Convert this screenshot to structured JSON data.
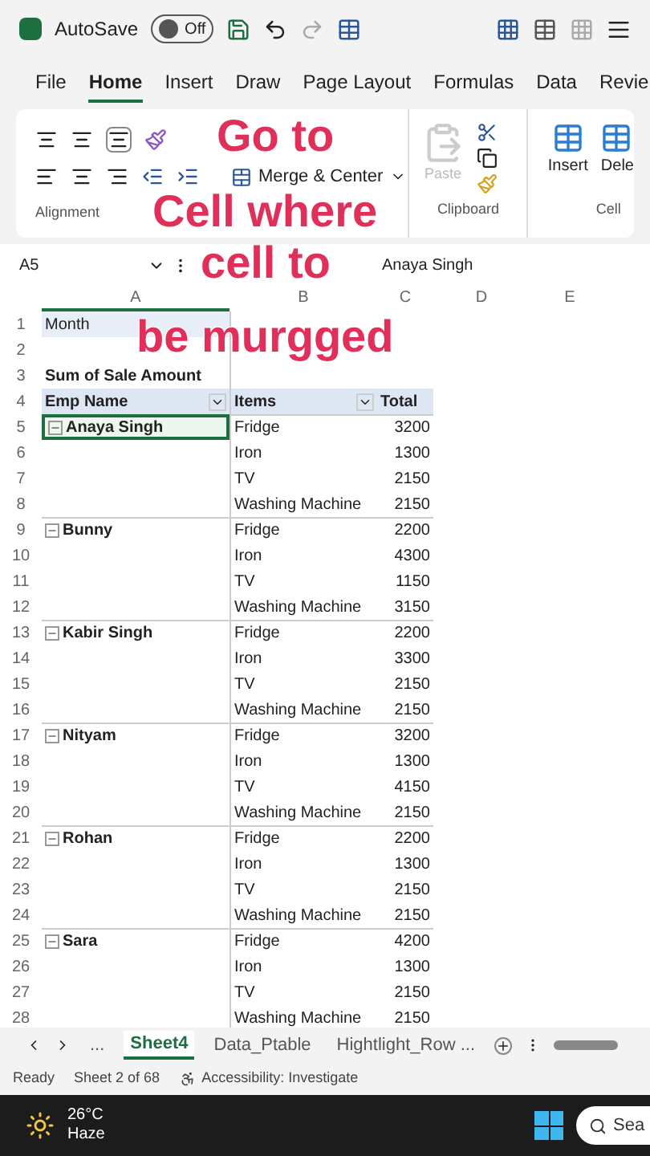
{
  "title_bar": {
    "autosave_label": "AutoSave",
    "autosave": {
      "on": false,
      "label": "Off"
    }
  },
  "menu_tabs": [
    {
      "label": "File",
      "selected": false
    },
    {
      "label": "Home",
      "selected": true
    },
    {
      "label": "Insert",
      "selected": false
    },
    {
      "label": "Draw",
      "selected": false
    },
    {
      "label": "Page Layout",
      "selected": false
    },
    {
      "label": "Formulas",
      "selected": false
    },
    {
      "label": "Data",
      "selected": false
    },
    {
      "label": "Revie",
      "selected": false
    }
  ],
  "ribbon": {
    "merge_button": "Merge & Center",
    "alignment_label": "Alignment",
    "paste": {
      "label": "Paste",
      "disabled": true
    },
    "clipboard_label": "Clipboard",
    "insert": "Insert",
    "delete": "Dele",
    "cells_label": "Cell"
  },
  "formula_bar": {
    "name_box": "A5",
    "value": "Anaya Singh"
  },
  "columns": [
    {
      "label": "A",
      "selected": true
    },
    {
      "label": "B",
      "selected": false
    },
    {
      "label": "C",
      "selected": false
    },
    {
      "label": "D",
      "selected": false
    },
    {
      "label": "E",
      "selected": false
    }
  ],
  "rows": [
    {
      "n": "1",
      "kind": "filter",
      "a": "Month",
      "selected": false
    },
    {
      "n": "2",
      "kind": "blank",
      "selected": false
    },
    {
      "n": "3",
      "kind": "title",
      "a": "Sum of Sale Amount",
      "selected": false
    },
    {
      "n": "4",
      "kind": "header",
      "a": "Emp Name",
      "b": "Items",
      "c": "Total",
      "selected": false
    },
    {
      "n": "5",
      "kind": "group",
      "a": "Anaya Singh",
      "b": "Fridge",
      "c": "3200",
      "selected": true
    },
    {
      "n": "6",
      "kind": "item",
      "b": "Iron",
      "c": "1300",
      "selected": false
    },
    {
      "n": "7",
      "kind": "item",
      "b": "TV",
      "c": "2150",
      "selected": false
    },
    {
      "n": "8",
      "kind": "item",
      "b": "Washing Machine",
      "c": "2150",
      "selected": false
    },
    {
      "n": "9",
      "kind": "group",
      "a": "Bunny",
      "b": "Fridge",
      "c": "2200",
      "selected": false
    },
    {
      "n": "10",
      "kind": "item",
      "b": "Iron",
      "c": "4300",
      "selected": false
    },
    {
      "n": "11",
      "kind": "item",
      "b": "TV",
      "c": "1150",
      "selected": false
    },
    {
      "n": "12",
      "kind": "item",
      "b": "Washing Machine",
      "c": "3150",
      "selected": false
    },
    {
      "n": "13",
      "kind": "group",
      "a": "Kabir Singh",
      "b": "Fridge",
      "c": "2200",
      "selected": false
    },
    {
      "n": "14",
      "kind": "item",
      "b": "Iron",
      "c": "3300",
      "selected": false
    },
    {
      "n": "15",
      "kind": "item",
      "b": "TV",
      "c": "2150",
      "selected": false
    },
    {
      "n": "16",
      "kind": "item",
      "b": "Washing Machine",
      "c": "2150",
      "selected": false
    },
    {
      "n": "17",
      "kind": "group",
      "a": "Nityam",
      "b": "Fridge",
      "c": "3200",
      "selected": false
    },
    {
      "n": "18",
      "kind": "item",
      "b": "Iron",
      "c": "1300",
      "selected": false
    },
    {
      "n": "19",
      "kind": "item",
      "b": "TV",
      "c": "4150",
      "selected": false
    },
    {
      "n": "20",
      "kind": "item",
      "b": "Washing Machine",
      "c": "2150",
      "selected": false
    },
    {
      "n": "21",
      "kind": "group",
      "a": "Rohan",
      "b": "Fridge",
      "c": "2200",
      "selected": false
    },
    {
      "n": "22",
      "kind": "item",
      "b": "Iron",
      "c": "1300",
      "selected": false
    },
    {
      "n": "23",
      "kind": "item",
      "b": "TV",
      "c": "2150",
      "selected": false
    },
    {
      "n": "24",
      "kind": "item",
      "b": "Washing Machine",
      "c": "2150",
      "selected": false
    },
    {
      "n": "25",
      "kind": "group",
      "a": "Sara",
      "b": "Fridge",
      "c": "4200",
      "selected": false
    },
    {
      "n": "26",
      "kind": "item",
      "b": "Iron",
      "c": "1300",
      "selected": false
    },
    {
      "n": "27",
      "kind": "item",
      "b": "TV",
      "c": "2150",
      "selected": false
    },
    {
      "n": "28",
      "kind": "item",
      "b": "Washing Machine",
      "c": "2150",
      "selected": false
    }
  ],
  "sheet_tabs": [
    {
      "label": "...",
      "selected": false
    },
    {
      "label": "Sheet4",
      "selected": true
    },
    {
      "label": "Data_Ptable",
      "selected": false
    },
    {
      "label": "Hightlight_Row ...",
      "selected": false
    }
  ],
  "status_bar": {
    "ready": "Ready",
    "sheet": "Sheet 2 of 68",
    "accessibility": "Accessibility: Investigate"
  },
  "taskbar": {
    "temperature": "26°C",
    "condition": "Haze",
    "search_placeholder": "Sea"
  },
  "annotation": [
    "Go to",
    "Cell where",
    "cell to",
    "be murgged"
  ]
}
